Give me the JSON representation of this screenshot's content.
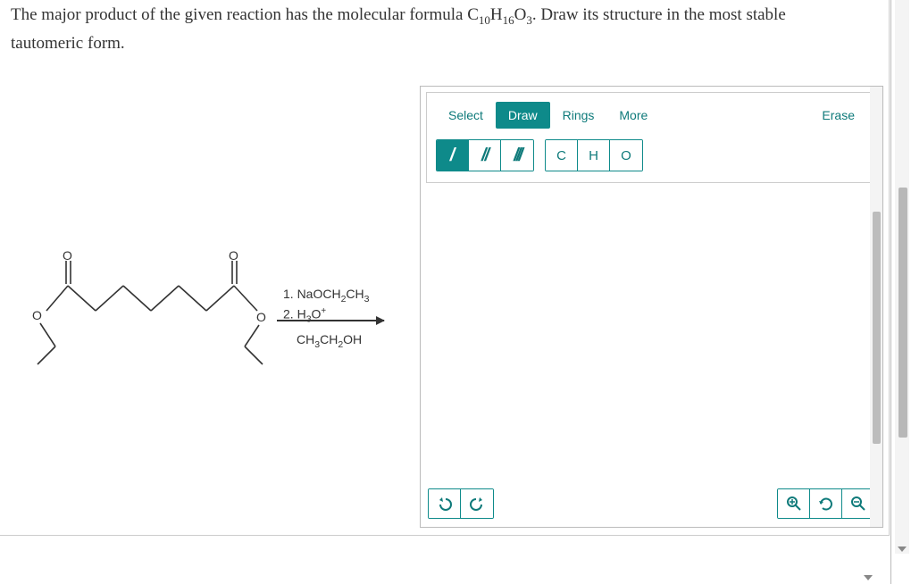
{
  "question": {
    "prefix": "The major product of the given reaction has the molecular formula C",
    "sub1": "10",
    "mid1": "H",
    "sub2": "16",
    "mid2": "O",
    "sub3": "3",
    "suffix": ". Draw its structure in the most stable tautomeric form."
  },
  "reagents": {
    "line1_prefix": "1. NaOCH",
    "line1_sub1": "2",
    "line1_mid": "CH",
    "line1_sub2": "3",
    "line2_prefix": "2. H",
    "line2_sub": "3",
    "line2_mid": "O",
    "line2_sup": "+"
  },
  "byproduct": {
    "prefix": "CH",
    "sub1": "3",
    "mid1": "CH",
    "sub2": "2",
    "suffix": "OH"
  },
  "toolbar": {
    "tabs": {
      "select": "Select",
      "draw": "Draw",
      "rings": "Rings",
      "more": "More"
    },
    "erase": "Erase",
    "atoms": {
      "c": "C",
      "h": "H",
      "o": "O"
    },
    "bonds": {
      "single": "/",
      "double": "//",
      "triple": "///"
    }
  },
  "icons": {
    "undo": "↶",
    "redo": "↷",
    "zoom_in": "⊕",
    "zoom_reset": "⟲",
    "zoom_out": "⊖"
  }
}
